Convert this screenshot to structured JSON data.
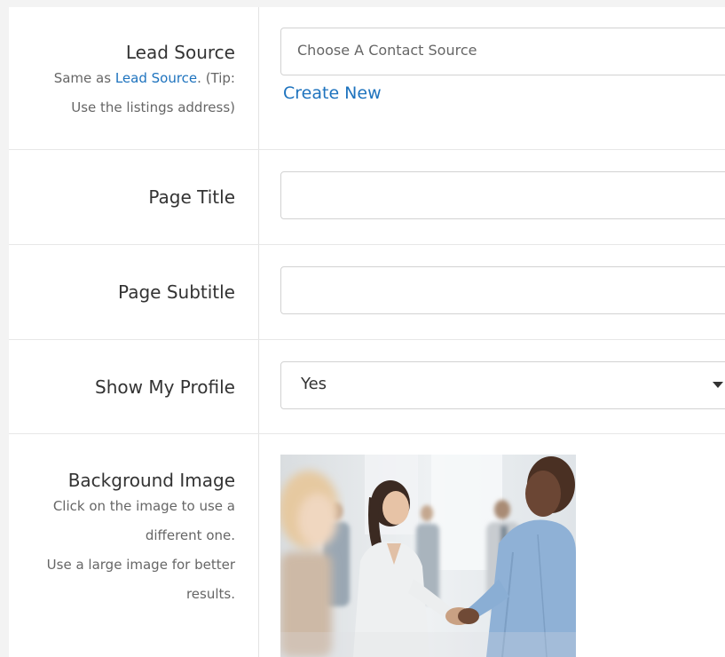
{
  "lead_source": {
    "label": "Lead Source",
    "hint_prefix": "Same as ",
    "hint_link": "Lead Source",
    "hint_suffix": ". (Tip:",
    "hint_line2": "Use the listings address)",
    "placeholder": "Choose A Contact Source",
    "create_new": "Create New"
  },
  "page_title": {
    "label": "Page Title",
    "value": ""
  },
  "page_subtitle": {
    "label": "Page Subtitle",
    "value": ""
  },
  "show_my_profile": {
    "label": "Show My Profile",
    "value": "Yes",
    "icon": "caret-down-icon"
  },
  "background_image": {
    "label": "Background Image",
    "hint_line1": "Click on the image to use a",
    "hint_line2": "different one.",
    "hint_line3": "Use a large image for better",
    "hint_line4": "results."
  }
}
